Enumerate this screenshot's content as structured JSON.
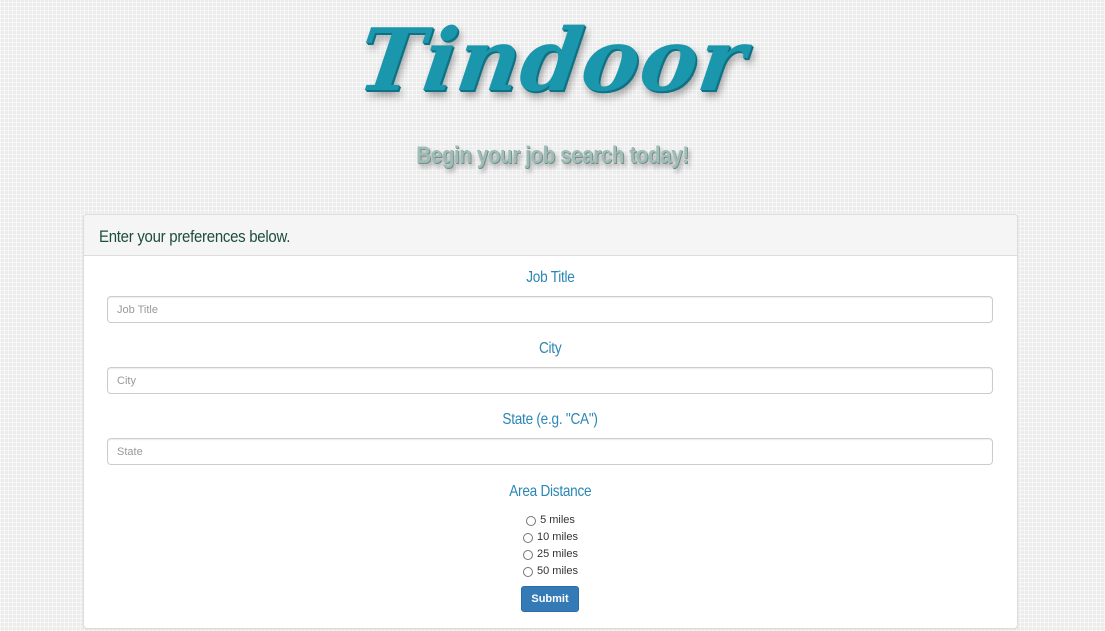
{
  "hero": {
    "brand": "Tindoor",
    "tagline": "Begin your job search today!"
  },
  "panel": {
    "heading": "Enter your preferences below."
  },
  "form": {
    "job_title": {
      "label": "Job Title",
      "placeholder": "Job Title",
      "value": ""
    },
    "city": {
      "label": "City",
      "placeholder": "City",
      "value": ""
    },
    "state": {
      "label": "State (e.g. \"CA\")",
      "placeholder": "State",
      "value": ""
    },
    "distance": {
      "label": "Area Distance",
      "options": [
        "5 miles",
        "10 miles",
        "25 miles",
        "50 miles"
      ],
      "selected": null
    },
    "submit_label": "Submit"
  },
  "colors": {
    "brand": "#1b97ad",
    "tagline": "#9fbdb6",
    "label": "#2a86b5",
    "heading_text": "#1d4d3f",
    "button": "#337ab7"
  }
}
